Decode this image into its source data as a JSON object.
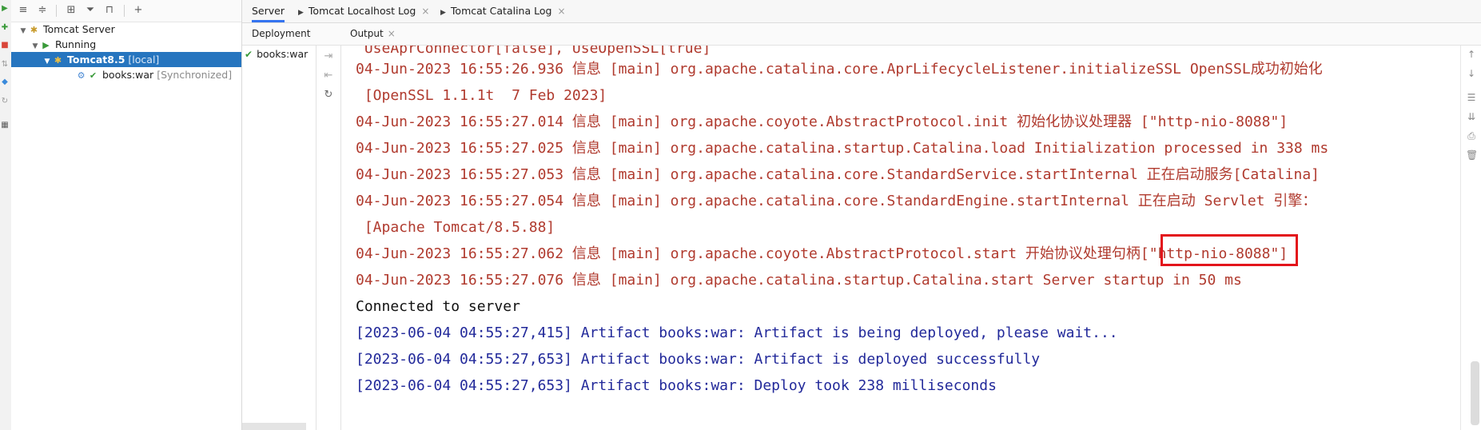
{
  "tree": {
    "nodes": [
      {
        "label": "Tomcat Server",
        "suffix": ""
      },
      {
        "label": "Running",
        "suffix": ""
      },
      {
        "label": "Tomcat8.5",
        "suffix": "[local]"
      },
      {
        "label": "books:war",
        "suffix": "[Synchronized]"
      }
    ]
  },
  "tabs": [
    {
      "label": "Server"
    },
    {
      "label": "Tomcat Localhost Log"
    },
    {
      "label": "Tomcat Catalina Log"
    }
  ],
  "subheaders": {
    "deployment": "Deployment",
    "output": "Output"
  },
  "deployment_items": [
    {
      "label": "books:war"
    }
  ],
  "console": {
    "lines": [
      {
        "text": " UseAprConnector[false], UseOpenSSL[true]",
        "color": "red"
      },
      {
        "text": "04-Jun-2023 16:55:26.936 信息 [main] org.apache.catalina.core.AprLifecycleListener.initializeSSL OpenSSL成功初始化",
        "color": "red"
      },
      {
        "text": " [OpenSSL 1.1.1t  7 Feb 2023]",
        "color": "red"
      },
      {
        "text": "04-Jun-2023 16:55:27.014 信息 [main] org.apache.coyote.AbstractProtocol.init 初始化协议处理器 [\"http-nio-8088\"]",
        "color": "red"
      },
      {
        "text": "04-Jun-2023 16:55:27.025 信息 [main] org.apache.catalina.startup.Catalina.load Initialization processed in 338 ms",
        "color": "red"
      },
      {
        "text": "04-Jun-2023 16:55:27.053 信息 [main] org.apache.catalina.core.StandardService.startInternal 正在启动服务[Catalina]",
        "color": "red"
      },
      {
        "text": "04-Jun-2023 16:55:27.054 信息 [main] org.apache.catalina.core.StandardEngine.startInternal 正在启动 Servlet 引擎：",
        "color": "red"
      },
      {
        "text": " [Apache Tomcat/8.5.88]",
        "color": "red"
      },
      {
        "text": "04-Jun-2023 16:55:27.062 信息 [main] org.apache.coyote.AbstractProtocol.start 开始协议处理句柄[\"http-nio-8088\"]",
        "color": "red"
      },
      {
        "text": "04-Jun-2023 16:55:27.076 信息 [main] org.apache.catalina.startup.Catalina.start Server startup in 50 ms",
        "color": "red"
      },
      {
        "text": "Connected to server",
        "color": "black"
      },
      {
        "text": "[2023-06-04 04:55:27,415] Artifact books:war: Artifact is being deployed, please wait...",
        "color": "blue"
      },
      {
        "text": "[2023-06-04 04:55:27,653] Artifact books:war: Artifact is deployed successfully",
        "color": "blue"
      },
      {
        "text": "[2023-06-04 04:55:27,653] Artifact books:war: Deploy took 238 milliseconds",
        "color": "blue"
      }
    ]
  },
  "colors": {
    "selection": "#2675bf",
    "log_red": "#b03a2e",
    "log_blue": "#22299a",
    "highlight_box": "#e3141b",
    "active_tab": "#3574f0"
  }
}
